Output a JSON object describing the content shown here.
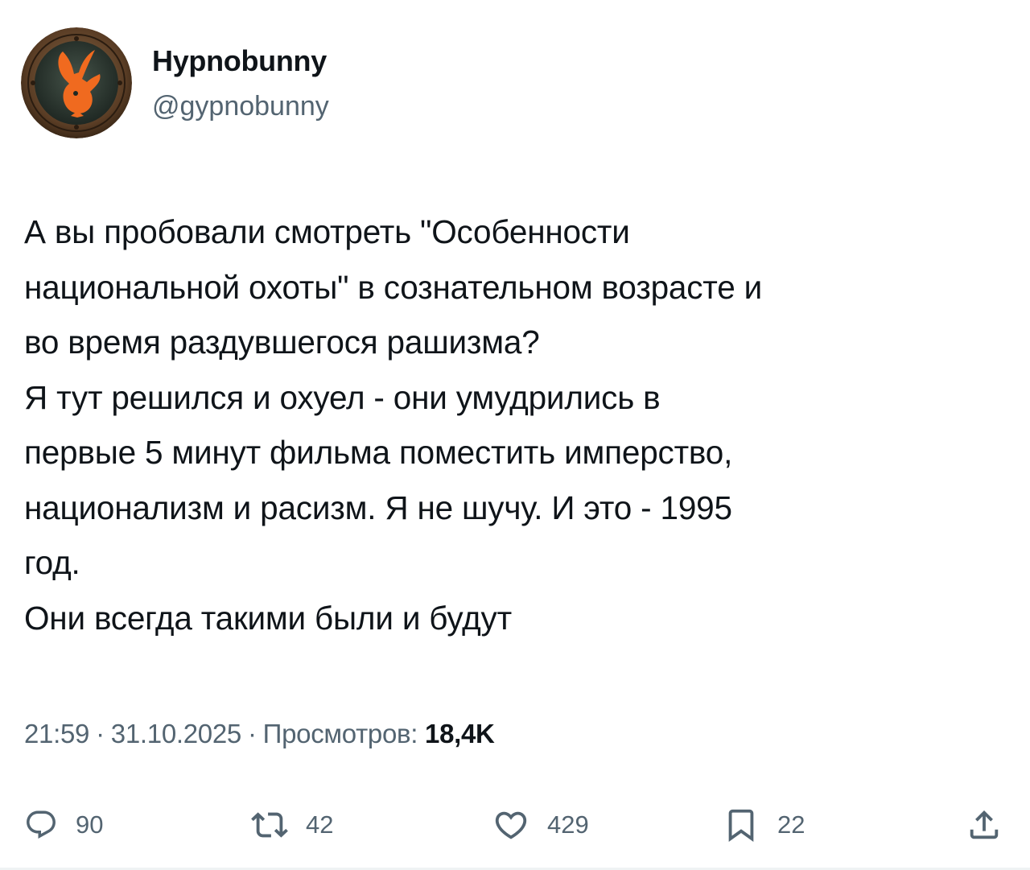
{
  "author": {
    "display_name": "Hypnobunny",
    "handle": "@gypnobunny",
    "avatar_icon": "playboy-bunny-emblem-icon",
    "avatar_colors": {
      "ring": "#6b4a2e",
      "inner": "#2f3a33",
      "bunny": "#f06a1f"
    }
  },
  "tweet": {
    "text": "А вы пробовали смотреть \"Особенности\nнациональной охоты\" в сознательном возрасте и\nво время раздувшегося рашизма?\nЯ тут решился и охуел - они умудрились в\nпервые 5 минут фильма поместить имперство,\nнационализм и расизм. Я не шучу. И это - 1995\nгод.\nОни всегда такими были и будут"
  },
  "meta": {
    "time": "21:59",
    "date": "31.10.2025",
    "separator": "·",
    "views_label": "Просмотров:",
    "views_count": "18,4K"
  },
  "actions": {
    "replies": {
      "icon": "reply-icon",
      "count": "90"
    },
    "retweets": {
      "icon": "retweet-icon",
      "count": "42"
    },
    "likes": {
      "icon": "heart-icon",
      "count": "429"
    },
    "bookmarks": {
      "icon": "bookmark-icon",
      "count": "22"
    },
    "share": {
      "icon": "share-icon"
    }
  },
  "colors": {
    "text_primary": "#0f1419",
    "text_secondary": "#536471",
    "background": "#ffffff"
  }
}
